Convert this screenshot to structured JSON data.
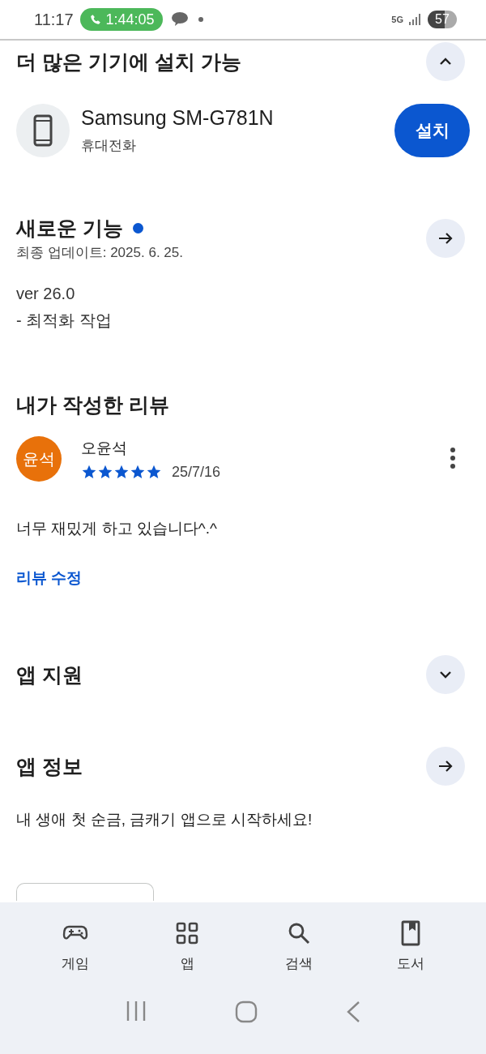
{
  "status_bar": {
    "time": "11:17",
    "call_timer": "1:44:05",
    "network": "5G",
    "battery": "57"
  },
  "install_section": {
    "title": "더 많은 기기에 설치 가능",
    "expanded": true,
    "device": {
      "name": "Samsung SM-G781N",
      "type": "휴대전화"
    },
    "install_button": "설치"
  },
  "whats_new": {
    "title": "새로운 기능",
    "unread": true,
    "updated": "최종 업데이트: 2025. 6. 25.",
    "notes": [
      "ver 26.0",
      "- 최적화 작업"
    ]
  },
  "my_review": {
    "title": "내가 작성한 리뷰",
    "avatar": "윤석",
    "author": "오윤석",
    "stars": 5,
    "date": "25/7/16",
    "text": "너무 재밌게 하고 있습니다^.^",
    "edit_link": "리뷰 수정"
  },
  "app_support": {
    "title": "앱 지원",
    "expanded": false
  },
  "app_info": {
    "title": "앱 정보",
    "description": "내 생애 첫 순금, 금캐기 앱으로 시작하세요!"
  },
  "bottom_nav": [
    {
      "label": "게임",
      "selected": false
    },
    {
      "label": "앱",
      "selected": false
    },
    {
      "label": "검색",
      "selected": false
    },
    {
      "label": "도서",
      "selected": false
    }
  ]
}
